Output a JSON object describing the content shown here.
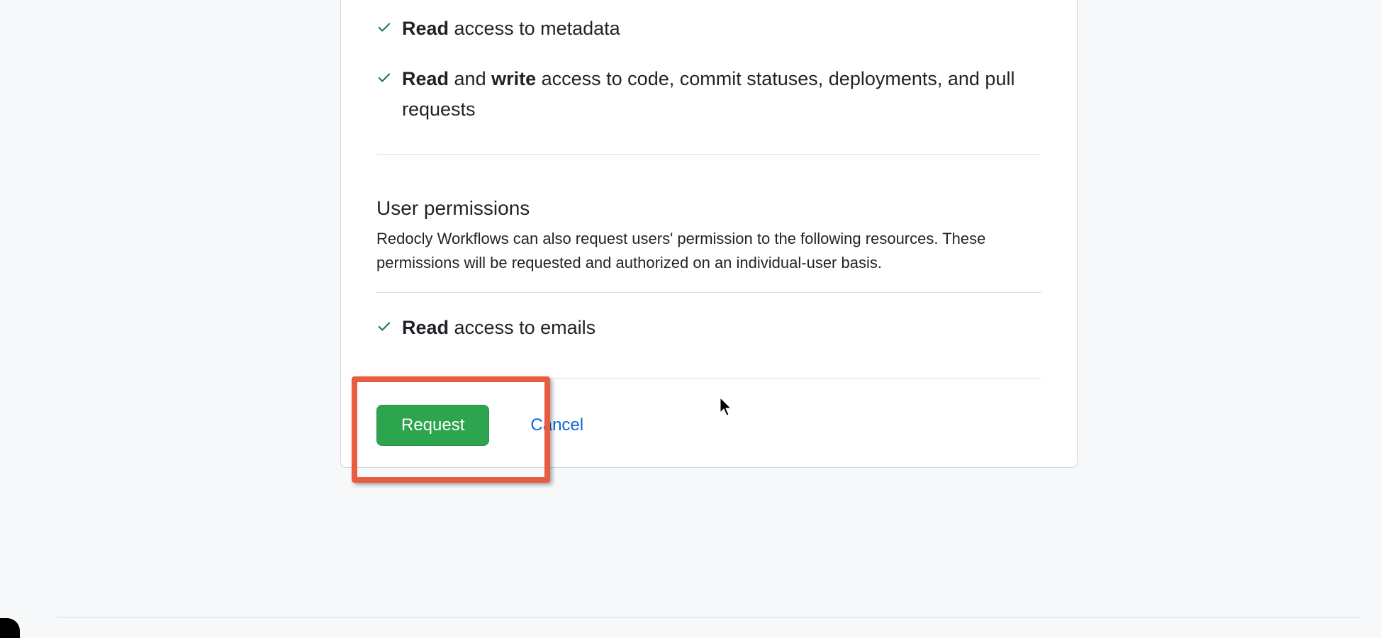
{
  "repo_permissions": {
    "items": [
      {
        "bold1": "Read",
        "rest": " access to metadata"
      },
      {
        "bold1": "Read",
        "mid": " and ",
        "bold2": "write",
        "rest": " access to code, commit statuses, deployments, and pull requests"
      }
    ]
  },
  "user_permissions": {
    "title": "User permissions",
    "description": "Redocly Workflows can also request users' permission to the following resources. These permissions will be requested and authorized on an individual-user basis.",
    "items": [
      {
        "bold1": "Read",
        "rest": " access to emails"
      }
    ]
  },
  "actions": {
    "request_label": "Request",
    "cancel_label": "Cancel"
  },
  "colors": {
    "success": "#1a7f37",
    "primary_btn": "#2da44e",
    "link": "#0969da",
    "highlight": "#e85c41"
  }
}
